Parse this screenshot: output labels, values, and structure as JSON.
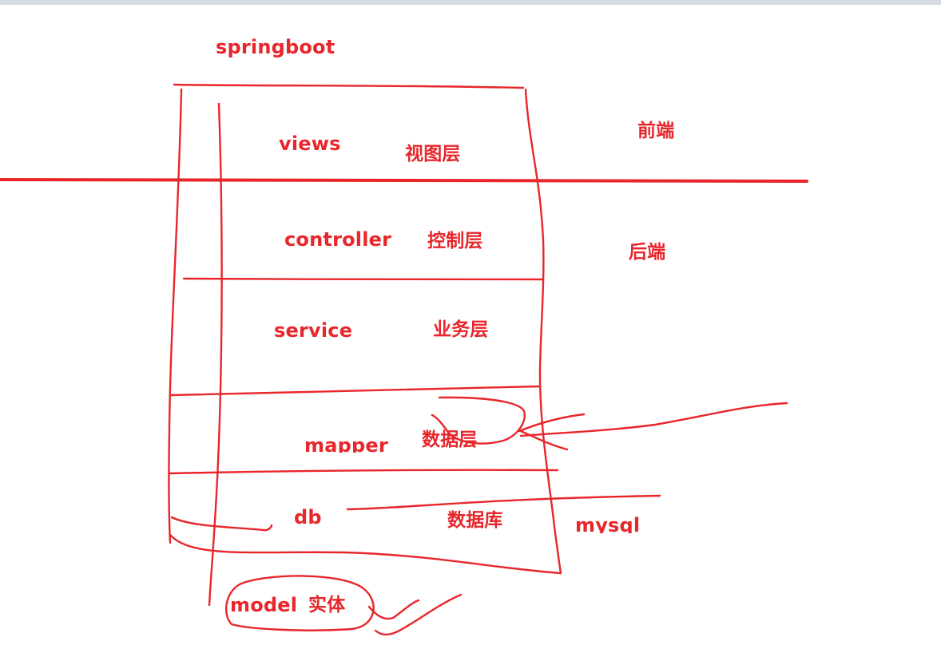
{
  "colors": {
    "ink": "#e8262b",
    "background": "#ffffff",
    "top_strip": "#d5dae3"
  },
  "labels": {
    "title": "springboot",
    "views": "views",
    "views_cn": "视图层",
    "frontend": "前端",
    "controller": "controller",
    "controller_cn": "控制层",
    "backend": "后端",
    "service": "service",
    "service_cn": "业务层",
    "mapper": "mapper",
    "mapper_cn": "数据层",
    "db": "db",
    "db_cn": "数据库",
    "mysql": "mysql",
    "model": "model",
    "model_cn": "实体"
  }
}
